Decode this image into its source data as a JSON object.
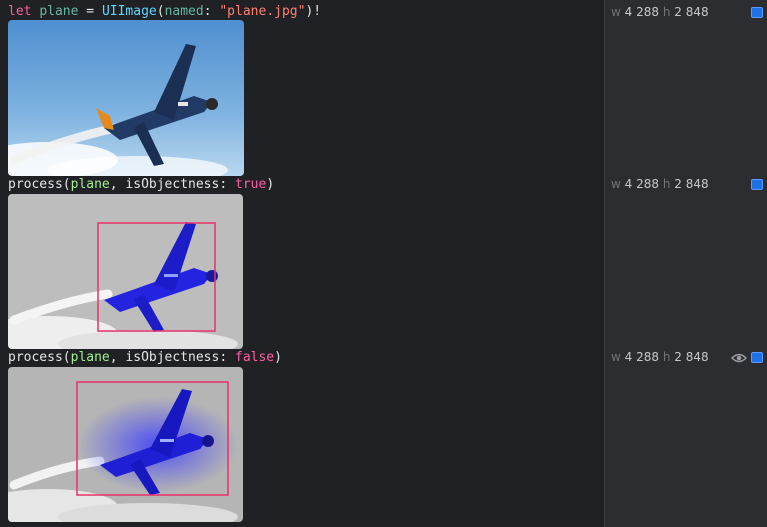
{
  "lines": [
    {
      "tokens": [
        {
          "text": "let",
          "cls": "kw"
        },
        {
          "text": " ",
          "cls": "pl"
        },
        {
          "text": "plane",
          "cls": "var"
        },
        {
          "text": " = ",
          "cls": "pl"
        },
        {
          "text": "UIImage",
          "cls": "ty"
        },
        {
          "text": "(",
          "cls": "pl"
        },
        {
          "text": "named",
          "cls": "var"
        },
        {
          "text": ": ",
          "cls": "pl"
        },
        {
          "text": "\"plane.jpg\"",
          "cls": "str"
        },
        {
          "text": ")!",
          "cls": "pl"
        }
      ]
    },
    {
      "tokens": [
        {
          "text": "process",
          "cls": "pl"
        },
        {
          "text": "(",
          "cls": "pl"
        },
        {
          "text": "plane",
          "cls": "arg"
        },
        {
          "text": ", isObjectness: ",
          "cls": "pl"
        },
        {
          "text": "true",
          "cls": "kw"
        },
        {
          "text": ")",
          "cls": "pl"
        }
      ]
    },
    {
      "tokens": [
        {
          "text": "process",
          "cls": "pl"
        },
        {
          "text": "(",
          "cls": "pl"
        },
        {
          "text": "plane",
          "cls": "arg"
        },
        {
          "text": ", isObjectness: ",
          "cls": "pl"
        },
        {
          "text": "false",
          "cls": "kw"
        },
        {
          "text": ")",
          "cls": "pl"
        }
      ]
    }
  ],
  "results": [
    {
      "w_label": "w",
      "w_value": "4 288",
      "h_label": "h",
      "h_value": "2 848"
    },
    {
      "w_label": "w",
      "w_value": "4 288",
      "h_label": "h",
      "h_value": "2 848"
    },
    {
      "w_label": "w",
      "w_value": "4 288",
      "h_label": "h",
      "h_value": "2 848"
    }
  ],
  "icons": {
    "quick_look": "quick-look-toggle",
    "eye": "eye-icon"
  },
  "colors": {
    "keyword": "#fc5fa3",
    "type": "#5dd8ff",
    "string": "#ff8170",
    "box": "#e8306a",
    "toggle": "#1f72e6"
  }
}
